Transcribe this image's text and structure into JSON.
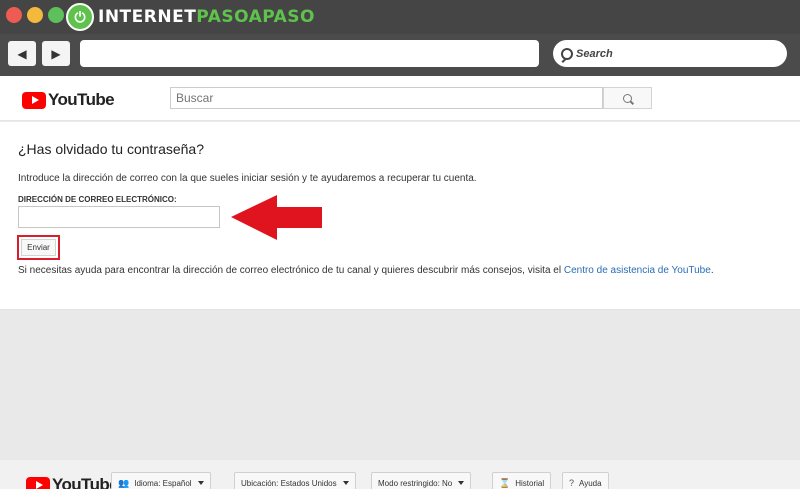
{
  "browser": {
    "brand_left": "INTERNET",
    "brand_right": "PASOAPASO",
    "search_placeholder": "Search",
    "back_icon": "arrow-left-icon",
    "forward_icon": "arrow-right-icon"
  },
  "youtube": {
    "logo_text": "YouTube",
    "search_placeholder": "Buscar"
  },
  "page": {
    "title": "¿Has olvidado tu contraseña?",
    "intro": "Introduce la dirección de correo con la que sueles iniciar sesión y te ayudaremos a recuperar tu cuenta.",
    "field_label": "DIRECCIÓN DE CORREO ELECTRÓNICO:",
    "email_value": "",
    "submit_label": "Enviar",
    "help_text": "Si necesitas ayuda para encontrar la dirección de correo electrónico de tu canal y quieres descubrir más consejos, visita el ",
    "help_link": "Centro de asistencia de YouTube",
    "help_end": "."
  },
  "annotation": {
    "arrow_color": "#e0141e",
    "highlight_color": "#d81e2a"
  },
  "footer": {
    "logo_text": "YouTube",
    "language": "Idioma: Español",
    "location": "Ubicación: Estados Unidos",
    "restricted": "Modo restringido: No",
    "history": "Historial",
    "help": "Ayuda"
  }
}
